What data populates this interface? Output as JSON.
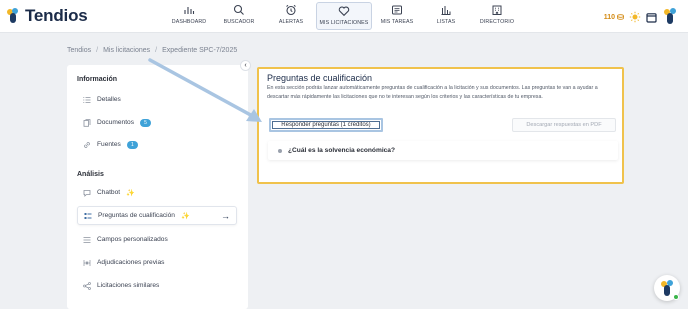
{
  "brand": {
    "name": "Tendios"
  },
  "nav": [
    {
      "label": "DASHBOARD",
      "icon": "bar-chart-icon"
    },
    {
      "label": "BUSCADOR",
      "icon": "search-icon"
    },
    {
      "label": "ALERTAS",
      "icon": "alarm-clock-icon"
    },
    {
      "label": "MIS LICITACIONES",
      "icon": "heart-icon",
      "active": true
    },
    {
      "label": "MIS TAREAS",
      "icon": "task-board-icon"
    },
    {
      "label": "LISTAS",
      "icon": "list-chart-icon"
    },
    {
      "label": "DIRECTORIO",
      "icon": "building-icon"
    }
  ],
  "topbar": {
    "credits": "110"
  },
  "breadcrumb": [
    "Tendios",
    "Mis licitaciones",
    "Expediente SPC-7/2025"
  ],
  "sidebar": {
    "section_info": "Información",
    "section_analysis": "Análisis",
    "items": [
      {
        "label": "Detalles",
        "icon": "list-icon"
      },
      {
        "label": "Documentos",
        "icon": "documents-icon",
        "badge": "5"
      },
      {
        "label": "Fuentes",
        "icon": "link-icon",
        "badge": "1"
      },
      {
        "label": "Chatbot",
        "icon": "chat-icon"
      },
      {
        "label": "Preguntas de cualificación",
        "icon": "checklist-icon",
        "active": true
      },
      {
        "label": "Campos personalizados",
        "icon": "fields-icon"
      },
      {
        "label": "Adjudicaciones previas",
        "icon": "awards-icon"
      },
      {
        "label": "Licitaciones similares",
        "icon": "similar-icon"
      }
    ]
  },
  "panel": {
    "title": "Preguntas de cualificación",
    "description": "En esta sección podrás lanzar automáticamente preguntas de cualificación a la licitación y sus documentos. Las preguntas te van a ayudar a descartar más rápidamente las licitaciones que no te interesan según los criterios y las características de tu empresa.",
    "answer_button": "Responder preguntas (1 créditos)",
    "pdf_button": "Descargar respuestas en PDF",
    "questions": [
      "¿Cuál es la solvencia económica?"
    ]
  },
  "colors": {
    "highlight_border": "#f0c24b",
    "accent": "#3fa2d8",
    "navy": "#1b2b48",
    "annotation": "#a9c5e2"
  }
}
